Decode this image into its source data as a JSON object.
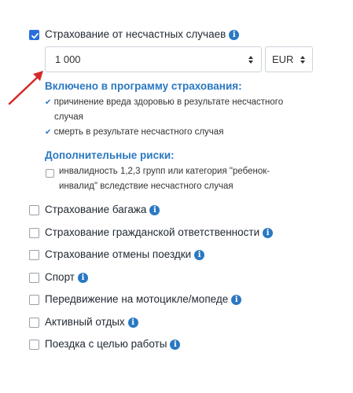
{
  "main_option": {
    "label": "Страхование от несчастных случаев",
    "checked": true,
    "amount_value": "1 000",
    "currency_value": "EUR"
  },
  "included": {
    "title": "Включено в программу страхования:",
    "items": [
      {
        "line1": "причинение вреда здоровью в результате несчастного",
        "line2": "случая"
      },
      {
        "line1": "смерть в результате несчастного случая"
      }
    ]
  },
  "additional": {
    "title": "Дополнительные риски:",
    "item_line1": "инвалидность 1,2,3 групп или категория \"ребенок-",
    "item_line2": "инвалид\" вследствие несчастного случая"
  },
  "options": [
    {
      "label": "Страхование багажа"
    },
    {
      "label": "Страхование гражданской ответственности"
    },
    {
      "label": "Страхование отмены поездки"
    },
    {
      "label": "Спорт"
    },
    {
      "label": "Передвижение на мотоцикле/мопеде"
    },
    {
      "label": "Активный отдых"
    },
    {
      "label": "Поездка с целью работы"
    }
  ],
  "colors": {
    "accent": "#2a78c2",
    "checkbox_checked": "#2a6fdb",
    "arrow": "#d42a2a"
  },
  "icons": {
    "info": "info-icon",
    "check": "check-icon",
    "select_arrows": "updown-arrows-icon",
    "pointer_arrow": "red-arrow-icon"
  }
}
